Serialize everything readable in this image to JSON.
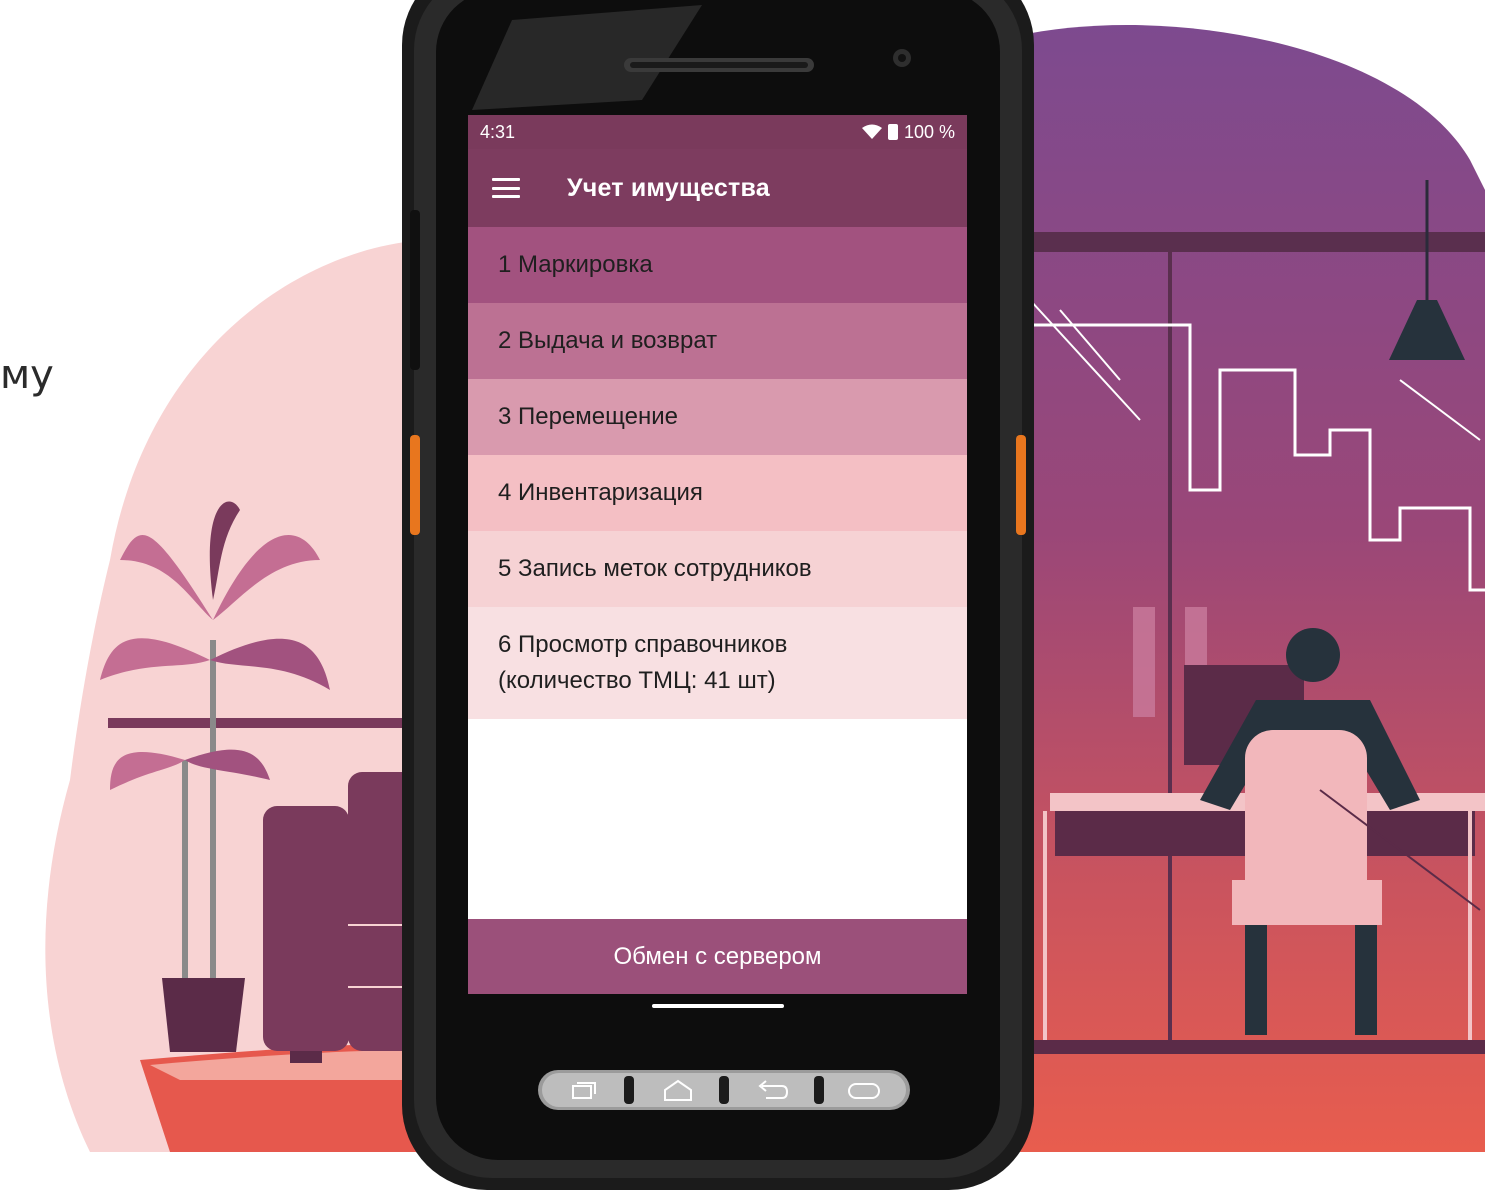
{
  "background": {
    "side_text": "му",
    "colors": {
      "blob_pink": "#f7d4d4",
      "blob_purple": "#7d4a8f",
      "blob_coral": "#e95d4f"
    }
  },
  "status_bar": {
    "time": "4:31",
    "battery": "100 %",
    "icons": [
      "wifi-icon",
      "battery-icon"
    ]
  },
  "app_bar": {
    "menu_icon": "hamburger-menu-icon",
    "title": "Учет имущества",
    "color": "#7d3c5f"
  },
  "menu": {
    "items": [
      {
        "label": "1 Маркировка",
        "color": "#a2527f"
      },
      {
        "label": "2 Выдача и возврат",
        "color": "#bc7193"
      },
      {
        "label": "3 Перемещение",
        "color": "#d99aae"
      },
      {
        "label": "4 Инвентаризация",
        "color": "#f4bfc4"
      },
      {
        "label": "5 Запись меток сотрудников",
        "color": "#f6d2d4"
      },
      {
        "label": "6 Просмотр справочников\n(количество ТМЦ: 41 шт)",
        "color": "#f8e0e2"
      }
    ]
  },
  "footer": {
    "sync_button": "Обмен с сервером",
    "color": "#9b507a"
  },
  "device_buttons": [
    "recent-apps-icon",
    "home-icon",
    "back-icon",
    "scan-icon"
  ]
}
